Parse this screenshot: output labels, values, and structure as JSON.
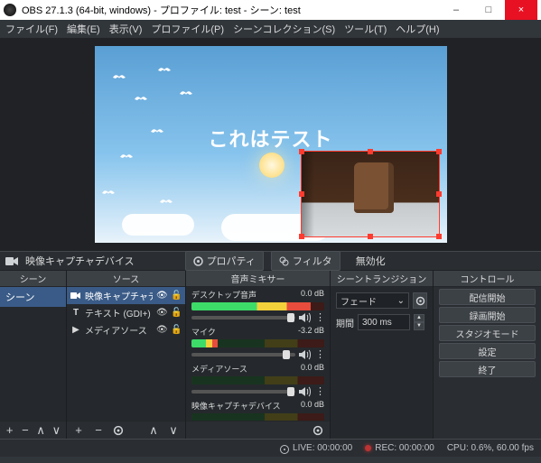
{
  "window": {
    "title": "OBS 27.1.3 (64-bit, windows) - プロファイル: test - シーン: test",
    "minimize": "–",
    "maximize": "□",
    "close": "×"
  },
  "menu": {
    "file": "ファイル(F)",
    "edit": "編集(E)",
    "view": "表示(V)",
    "profile": "プロファイル(P)",
    "scenecoll": "シーンコレクション(S)",
    "tools": "ツール(T)",
    "help": "ヘルプ(H)"
  },
  "preview": {
    "caption": "これはテスト"
  },
  "contextbar": {
    "selected_source": "映像キャプチャデバイス",
    "properties": "プロパティ",
    "filters": "フィルタ",
    "disable": "無効化"
  },
  "panels": {
    "scenes_title": "シーン",
    "sources_title": "ソース",
    "mixer_title": "音声ミキサー",
    "transitions_title": "シーントランジション",
    "controls_title": "コントロール"
  },
  "scenes": {
    "items": [
      "シーン"
    ]
  },
  "sources": {
    "items": [
      {
        "icon": "camera",
        "label": "映像キャプチャデバ",
        "visible": true,
        "locked": false
      },
      {
        "icon": "text",
        "label": "テキスト (GDI+)",
        "visible": true,
        "locked": false
      },
      {
        "icon": "media",
        "label": "メディアソース",
        "visible": true,
        "locked": false
      }
    ]
  },
  "mixer": {
    "channels": [
      {
        "name": "デスクトップ音声",
        "db": "0.0 dB",
        "fill": 90,
        "knob": 92
      },
      {
        "name": "マイク",
        "db": "-3.2 dB",
        "fill": 20,
        "knob": 88
      },
      {
        "name": "メディアソース",
        "db": "0.0 dB",
        "fill": 0,
        "knob": 92
      },
      {
        "name": "映像キャプチャデバイス",
        "db": "0.0 dB",
        "fill": 0,
        "knob": 92
      }
    ]
  },
  "transitions": {
    "selected": "フェード",
    "duration_label": "期間",
    "duration_value": "300 ms"
  },
  "controls": {
    "start_stream": "配信開始",
    "start_record": "録画開始",
    "studio_mode": "スタジオモード",
    "settings": "設定",
    "exit": "終了"
  },
  "statusbar": {
    "live": "LIVE: 00:00:00",
    "rec": "REC: 00:00:00",
    "cpu": "CPU: 0.6%, 60.00 fps"
  }
}
